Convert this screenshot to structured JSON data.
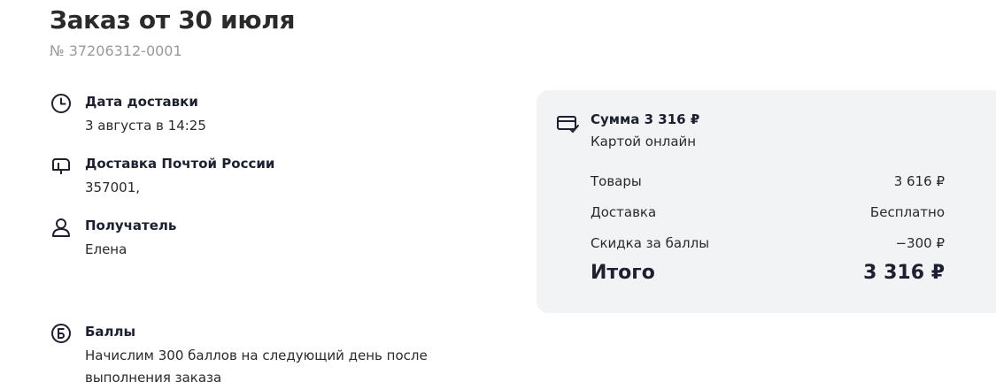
{
  "header": {
    "title": "Заказ от 30 июля",
    "order_number": "№ 37206312-0001"
  },
  "delivery_date": {
    "icon": "clock-icon",
    "heading": "Дата доставки",
    "value": "3 августа в 14:25"
  },
  "delivery_method": {
    "icon": "mailbox-icon",
    "heading": "Доставка Почтой России",
    "value": "357001,"
  },
  "recipient": {
    "icon": "user-icon",
    "heading": "Получатель",
    "value": "Елена"
  },
  "bonus": {
    "icon": "bonus-coin-icon",
    "heading": "Баллы",
    "value": "Начислим 300 баллов на следующий день после выполнения заказа"
  },
  "summary": {
    "icon": "card-check-icon",
    "heading": "Сумма 3 316 ₽",
    "payment_method": "Картой онлайн",
    "rows": [
      {
        "label": "Товары",
        "amount": "3 616 ₽"
      },
      {
        "label": "Доставка",
        "amount": "Бесплатно"
      },
      {
        "label": "Скидка за баллы",
        "amount": "−300 ₽"
      }
    ],
    "total": {
      "label": "Итого",
      "amount": "3 316 ₽"
    }
  }
}
